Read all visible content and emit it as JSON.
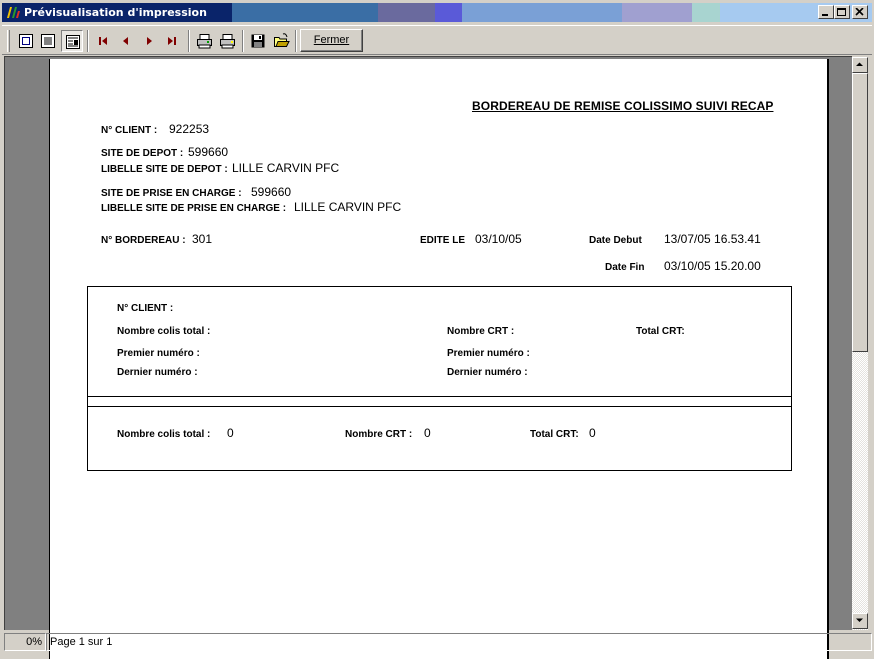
{
  "window": {
    "title": "Prévisualisation d'impression",
    "controls": [
      "minimize-icon",
      "maximize-icon",
      "close-icon"
    ]
  },
  "toolbar": {
    "buttons": [
      {
        "name": "one-page-view",
        "icon": "single-page-icon"
      },
      {
        "name": "full-width-view",
        "icon": "page-width-icon"
      },
      {
        "name": "zoom-view",
        "icon": "zoom-page-icon",
        "pressed": true
      },
      {
        "name": "first-page",
        "icon": "first-page-icon"
      },
      {
        "name": "previous-page",
        "icon": "previous-page-icon"
      },
      {
        "name": "next-page",
        "icon": "next-page-icon"
      },
      {
        "name": "last-page",
        "icon": "last-page-icon"
      },
      {
        "name": "print-setup",
        "icon": "printer-setup-icon"
      },
      {
        "name": "print",
        "icon": "printer-icon"
      },
      {
        "name": "save",
        "icon": "floppy-disk-icon"
      },
      {
        "name": "open",
        "icon": "open-folder-icon"
      }
    ],
    "close_label": "Fermer"
  },
  "report": {
    "title": "BORDEREAU DE REMISE COLISSIMO SUIVI RECAP",
    "client_label": "N° CLIENT :",
    "client_value": "922253",
    "depot_label": "SITE DE DEPOT :",
    "depot_value": "599660",
    "depot_libelle_label": "LIBELLE SITE DE DEPOT :",
    "depot_libelle_value": "LILLE CARVIN PFC",
    "prise_label": "SITE DE PRISE EN CHARGE :",
    "prise_value": "599660",
    "prise_libelle_label": "LIBELLE SITE DE PRISE EN CHARGE :",
    "prise_libelle_value": "LILLE CARVIN PFC",
    "bordereau_label": "N° BORDEREAU :",
    "bordereau_value": "301",
    "edite_label": "EDITE LE",
    "edite_value": "03/10/05",
    "date_debut_label": "Date Debut",
    "date_debut_value": "13/07/05 16.53.41",
    "date_fin_label": "Date Fin",
    "date_fin_value": "03/10/05 15.20.00",
    "detail": {
      "client_label": "N° CLIENT :",
      "nombre_colis_label": "Nombre colis total :",
      "nombre_crt_label": "Nombre CRT :",
      "total_crt_label": "Total CRT:",
      "premier_numero_label": "Premier numéro :",
      "premier_numero_crt_label": "Premier numéro :",
      "dernier_numero_label": "Dernier numéro :",
      "dernier_numero_crt_label": "Dernier numéro :"
    },
    "totals": {
      "nombre_colis_label": "Nombre colis total :",
      "nombre_colis_value": "0",
      "nombre_crt_label": "Nombre CRT :",
      "nombre_crt_value": "0",
      "total_crt_label": "Total CRT:",
      "total_crt_value": "0"
    }
  },
  "status": {
    "zoom": "0%",
    "page": "Page 1 sur 1"
  }
}
